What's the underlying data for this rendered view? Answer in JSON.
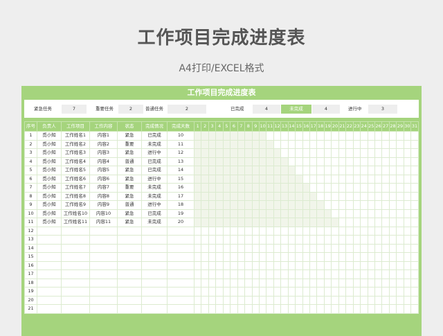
{
  "page": {
    "title": "工作项目完成进度表",
    "subtitle": "A4打印/EXCEL格式"
  },
  "sheet": {
    "title": "工作项目完成进度表"
  },
  "stats": [
    {
      "label": "紧急任务",
      "value": "7"
    },
    {
      "label": "重要任务",
      "value": "2"
    },
    {
      "label": "普通任务",
      "value": "2"
    },
    {
      "label": "已完成",
      "value": "4"
    },
    {
      "label": "未完成",
      "value": "4"
    },
    {
      "label": "进行中",
      "value": "3"
    }
  ],
  "table": {
    "headers": [
      "序号",
      "负责人",
      "工作项目",
      "工作内容",
      "状态",
      "完成情况",
      "完成天数"
    ],
    "day_headers": [
      "1",
      "2",
      "3",
      "4",
      "5",
      "6",
      "7",
      "8",
      "9",
      "10",
      "11",
      "12",
      "13",
      "14",
      "15",
      "16",
      "17",
      "18",
      "19",
      "20",
      "21",
      "22",
      "23",
      "24",
      "25",
      "26",
      "27",
      "28",
      "29",
      "30",
      "31"
    ],
    "rows": [
      {
        "no": "1",
        "owner": "觅小知",
        "project": "工作姓名1",
        "content": "内容1",
        "status": "紧急",
        "progress": "已完成",
        "days": "10"
      },
      {
        "no": "2",
        "owner": "觅小知",
        "project": "工作姓名2",
        "content": "内容2",
        "status": "重要",
        "progress": "未完成",
        "days": "11"
      },
      {
        "no": "3",
        "owner": "觅小知",
        "project": "工作姓名3",
        "content": "内容3",
        "status": "紧急",
        "progress": "进行中",
        "days": "12"
      },
      {
        "no": "4",
        "owner": "觅小知",
        "project": "工作姓名4",
        "content": "内容4",
        "status": "普通",
        "progress": "已完成",
        "days": "13"
      },
      {
        "no": "5",
        "owner": "觅小知",
        "project": "工作姓名5",
        "content": "内容5",
        "status": "紧急",
        "progress": "已完成",
        "days": "14"
      },
      {
        "no": "6",
        "owner": "觅小知",
        "project": "工作姓名6",
        "content": "内容6",
        "status": "紧急",
        "progress": "进行中",
        "days": "15"
      },
      {
        "no": "7",
        "owner": "觅小知",
        "project": "工作姓名7",
        "content": "内容7",
        "status": "重要",
        "progress": "未完成",
        "days": "16"
      },
      {
        "no": "8",
        "owner": "觅小知",
        "project": "工作姓名8",
        "content": "内容8",
        "status": "紧急",
        "progress": "未完成",
        "days": "17"
      },
      {
        "no": "9",
        "owner": "觅小知",
        "project": "工作姓名9",
        "content": "内容9",
        "status": "普通",
        "progress": "进行中",
        "days": "18"
      },
      {
        "no": "10",
        "owner": "觅小知",
        "project": "工作姓名10",
        "content": "内容10",
        "status": "紧急",
        "progress": "已完成",
        "days": "19"
      },
      {
        "no": "11",
        "owner": "觅小知",
        "project": "工作姓名11",
        "content": "内容11",
        "status": "紧急",
        "progress": "未完成",
        "days": "20"
      },
      {
        "no": "12",
        "owner": "",
        "project": "",
        "content": "",
        "status": "",
        "progress": "",
        "days": ""
      },
      {
        "no": "13",
        "owner": "",
        "project": "",
        "content": "",
        "status": "",
        "progress": "",
        "days": ""
      },
      {
        "no": "14",
        "owner": "",
        "project": "",
        "content": "",
        "status": "",
        "progress": "",
        "days": ""
      },
      {
        "no": "15",
        "owner": "",
        "project": "",
        "content": "",
        "status": "",
        "progress": "",
        "days": ""
      },
      {
        "no": "16",
        "owner": "",
        "project": "",
        "content": "",
        "status": "",
        "progress": "",
        "days": ""
      },
      {
        "no": "17",
        "owner": "",
        "project": "",
        "content": "",
        "status": "",
        "progress": "",
        "days": ""
      },
      {
        "no": "18",
        "owner": "",
        "project": "",
        "content": "",
        "status": "",
        "progress": "",
        "days": ""
      },
      {
        "no": "19",
        "owner": "",
        "project": "",
        "content": "",
        "status": "",
        "progress": "",
        "days": ""
      },
      {
        "no": "20",
        "owner": "",
        "project": "",
        "content": "",
        "status": "",
        "progress": "",
        "days": ""
      },
      {
        "no": "21",
        "owner": "",
        "project": "",
        "content": "",
        "status": "",
        "progress": "",
        "days": ""
      }
    ]
  },
  "colors": {
    "accent": "#a5d47d",
    "gantt_fill": "#f1f5ea",
    "background": "#eeeeee"
  }
}
